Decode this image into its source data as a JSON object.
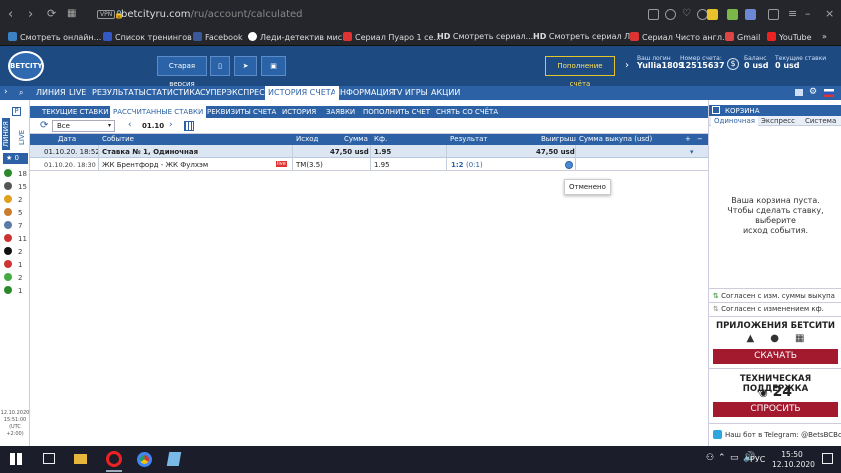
{
  "browser": {
    "url_host": "betcityru.com",
    "url_path": "/ru/account/calculated",
    "vpn_label": "VPN"
  },
  "bookmarks": [
    {
      "label": "Смотреть онлайн...",
      "color": "#3b82c4"
    },
    {
      "label": "Список тренингов",
      "color": "#3358c4"
    },
    {
      "label": "Facebook",
      "color": "#3b5998"
    },
    {
      "label": "Леди-детектив мис...",
      "color": "#ffffff"
    },
    {
      "label": "Сериал Пуаро 1 се...",
      "color": "#d33"
    },
    {
      "label": "Смотреть сериал...",
      "color": "#333"
    },
    {
      "label": "Смотреть сериал Л...",
      "color": "#333"
    },
    {
      "label": "Сериал Чисто англ...",
      "color": "#d33"
    },
    {
      "label": "Gmail",
      "color": "#d44"
    },
    {
      "label": "YouTube",
      "color": "#e22"
    }
  ],
  "bookmark_prefix": {
    "hd": "HD",
    "more": "»"
  },
  "header": {
    "logo": "BETCITY",
    "old_version": "Старая версия",
    "deposit": "Пополнение счёта",
    "login_label": "Ваш логин",
    "login_value": "Yullia1809",
    "account_label": "Номер счета:",
    "account_value": "12515637",
    "balance_label": "Баланс",
    "balance_value": "0 usd",
    "bets_label": "Текущие ставки",
    "bets_value": "0 usd"
  },
  "mainmenu": [
    "ЛИНИЯ",
    "LIVE",
    "РЕЗУЛЬТАТЫ",
    "СТАТИСТИКА",
    "СУПЕРЭКСПРЕСС",
    "ИСТОРИЯ СЧЕТА",
    "ИНФОРМАЦИЯ",
    "TV ИГРЫ",
    "АКЦИИ"
  ],
  "mainmenu_active": "ИСТОРИЯ СЧЕТА",
  "submenu": [
    "ТЕКУЩИЕ СТАВКИ",
    "РАССЧИТАННЫЕ СТАВКИ",
    "РЕКВИЗИТЫ СЧЕТА",
    "ИСТОРИЯ",
    "ЗАЯВКИ",
    "ПОПОЛНИТЬ СЧЕТ",
    "СНЯТЬ СО СЧЁТА"
  ],
  "submenu_active": "РАССЧИТАННЫЕ СТАВКИ",
  "leftnav": {
    "line": "ЛИНИЯ",
    "live": "LIVE",
    "fav_count": "0",
    "sports": [
      {
        "count": "18",
        "color": "#2a8a2a"
      },
      {
        "count": "15",
        "color": "#555"
      },
      {
        "count": "2",
        "color": "#e0a020"
      },
      {
        "count": "5",
        "color": "#c77d2a"
      },
      {
        "count": "7",
        "color": "#5a7aa8"
      },
      {
        "count": "11",
        "color": "#c33"
      },
      {
        "count": "2",
        "color": "#111"
      },
      {
        "count": "1",
        "color": "#c33"
      },
      {
        "count": "2",
        "color": "#4a4"
      },
      {
        "count": "1",
        "color": "#2a8a2a"
      }
    ],
    "datetime": [
      "12.10.2020",
      "15:51:00",
      "(UTC",
      "+2:00)"
    ]
  },
  "filter": {
    "select_value": "Все",
    "date": "01.10"
  },
  "table": {
    "headers": [
      "Дата",
      "Событие",
      "Исход",
      "Сумма",
      "Кф.",
      "Результат",
      "Выигрыш",
      "Сумма выкупа (usd)"
    ],
    "bet_row": {
      "date": "01.10.20. 18:52",
      "title": "Ставка № 1, Одиночная",
      "amount": "47,50 usd",
      "coef": "1.95",
      "win": "47,50 usd"
    },
    "event_row": {
      "date": "01.10.20. 18:30",
      "event": "ЖК Брентфорд - ЖК Фулхэм",
      "live": "live",
      "outcome": "ТМ(3.5)",
      "coef": "1.95",
      "result": "1:2",
      "result_detail": "(0:1)"
    },
    "tooltip": "Отменено"
  },
  "basket": {
    "title": "КОРЗИНА",
    "tabs": [
      "Одиночная",
      "Экспресс",
      "Система"
    ],
    "empty": [
      "Ваша корзина пуста.",
      "Чтобы сделать ставку, выберите",
      "исход события."
    ],
    "agree1": "Согласен с изм. суммы выкупа",
    "agree2": "Согласен с изменением кф.",
    "apps_title": "ПРИЛОЖЕНИЯ БЕТСИТИ",
    "download": "СКАЧАТЬ",
    "support_title": "ТЕХНИЧЕСКАЯ ПОДДЕРЖКА",
    "support_24": "24",
    "ask": "СПРОСИТЬ",
    "telegram": "Наш бот в Telegram: @BetsBCBot"
  },
  "taskbar": {
    "lang": "РУС",
    "time": "15:50",
    "date": "12.10.2020"
  }
}
